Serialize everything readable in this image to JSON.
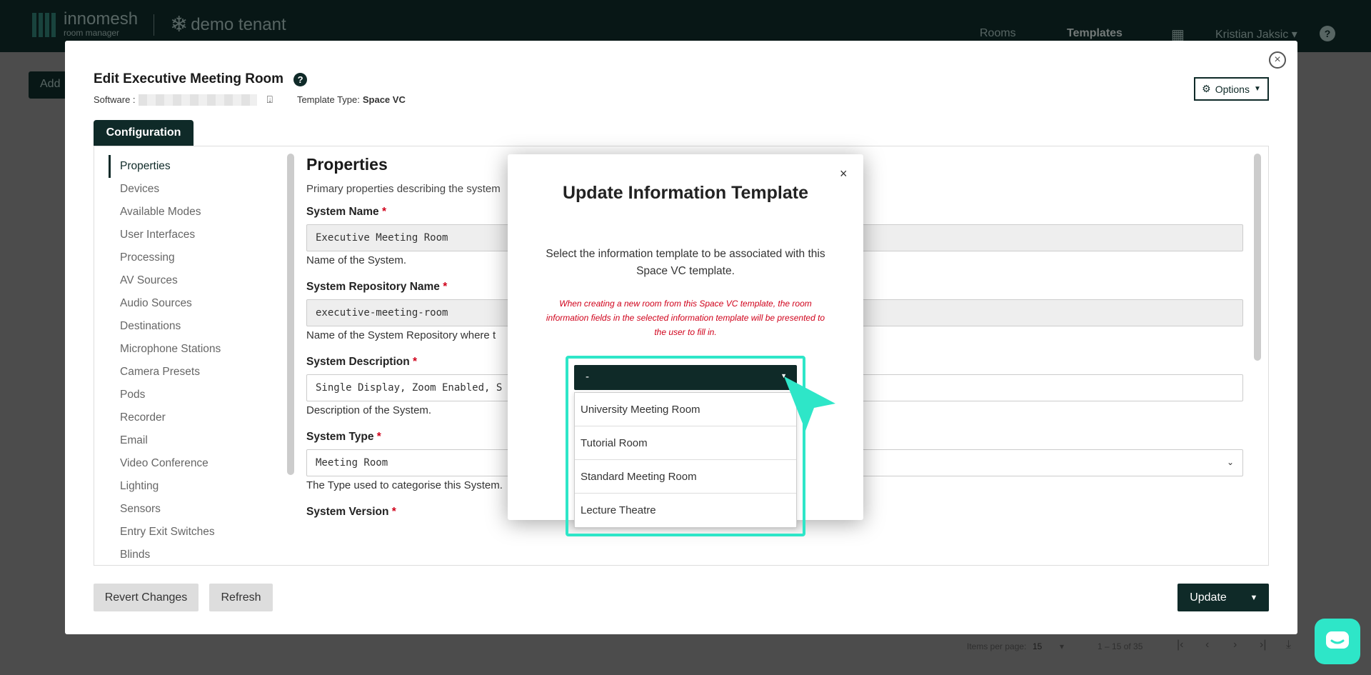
{
  "topbar": {
    "brand": "innomesh",
    "brand_sub": "room manager",
    "tenant": "demo tenant",
    "nav": {
      "rooms": "Rooms",
      "templates": "Templates",
      "user": "Kristian Jaksic"
    }
  },
  "background": {
    "add_label": "Add",
    "pager": {
      "items_per_page_label": "Items per page:",
      "items_per_page": "15",
      "range": "1 – 15 of 35"
    }
  },
  "modal": {
    "title": "Edit Executive Meeting Room",
    "software_label": "Software :",
    "template_type_label": "Template Type:",
    "template_type_value": "Space VC",
    "options_label": "Options",
    "tab_label": "Configuration",
    "sidebar": [
      "Properties",
      "Devices",
      "Available Modes",
      "User Interfaces",
      "Processing",
      "AV Sources",
      "Audio Sources",
      "Destinations",
      "Microphone Stations",
      "Camera Presets",
      "Pods",
      "Recorder",
      "Email",
      "Video Conference",
      "Lighting",
      "Sensors",
      "Entry Exit Switches",
      "Blinds"
    ],
    "content": {
      "title": "Properties",
      "description": "Primary properties describing the system",
      "fields": [
        {
          "label": "System Name",
          "value": "Executive Meeting Room",
          "help": "Name of the System."
        },
        {
          "label": "System Repository Name",
          "value": "executive-meeting-room",
          "help": "Name of the System Repository where t"
        },
        {
          "label": "System Description",
          "value": "Single Display, Zoom Enabled, S",
          "help": "Description of the System."
        },
        {
          "label": "System Type",
          "value": "Meeting Room",
          "help": "The Type used to categorise this System."
        },
        {
          "label": "System Version",
          "value": "",
          "help": ""
        }
      ],
      "required_mark": "*"
    },
    "footer": {
      "revert_label": "Revert Changes",
      "refresh_label": "Refresh",
      "update_label": "Update"
    }
  },
  "dialog": {
    "title": "Update Information Template",
    "text": "Select the information template to be associated with this Space VC template.",
    "warning": "When creating a new room from this Space VC template, the room information fields in the selected information template will be presented to the user to fill in.",
    "selected": "-",
    "options": [
      "University Meeting Room",
      "Tutorial Room",
      "Standard Meeting Room",
      "Lecture Theatre"
    ],
    "close": "×"
  },
  "colors": {
    "brand_dark": "#0f2a28",
    "accent": "#2ee6c8",
    "required": "#d0021b"
  }
}
